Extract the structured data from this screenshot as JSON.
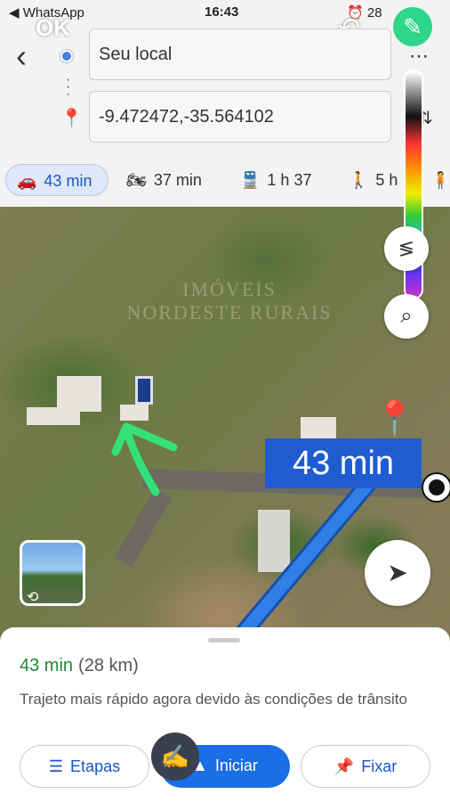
{
  "status_bar": {
    "back_app": "◀ WhatsApp",
    "time": "16:43",
    "battery": "28"
  },
  "markup_toolbar": {
    "done_label": "OK",
    "undo_icon": "undo-icon",
    "pencil_icon": "pencil-icon"
  },
  "directions": {
    "origin": "Seu local",
    "destination": "-9.472472,-35.564102"
  },
  "modes": [
    {
      "icon": "car-icon",
      "label": "43 min",
      "active": true
    },
    {
      "icon": "motorcycle-icon",
      "label": "37 min",
      "active": false
    },
    {
      "icon": "train-icon",
      "label": "1 h 37",
      "active": false
    },
    {
      "icon": "walk-icon",
      "label": "5 h",
      "active": false
    }
  ],
  "watermark": {
    "line1": "IMÓVEIS",
    "line2": "NORDESTE RURAIS"
  },
  "map": {
    "route_time_label": "43 min",
    "route_color": "#2f7fe6",
    "annotation_color": "#34e07a"
  },
  "sheet": {
    "duration": "43 min",
    "distance": "(28 km)",
    "description": "Trajeto mais rápido agora devido às condições de trânsito",
    "steps_label": "Etapas",
    "start_label": "Iniciar",
    "pin_label": "Fixar"
  },
  "colors": {
    "accent_blue": "#1a6ee6",
    "duration_green": "#1f8a3a",
    "pin_red": "#e0442e"
  }
}
